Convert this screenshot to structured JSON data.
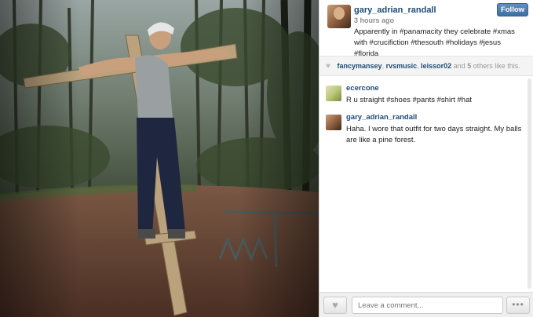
{
  "post": {
    "username": "gary_adrian_randall",
    "time_ago": "3 hours ago",
    "caption": "Apparently in #panamacity they celebrate #xmas with #crucifiction #thesouth #holidays #jesus #florida",
    "follow_label": "Follow"
  },
  "likes": {
    "users": [
      "fancymansey",
      "rvsmusic",
      "leissor02"
    ],
    "separator_1": ", ",
    "separator_2": ", ",
    "and_text": " and ",
    "others_count": "5",
    "others_suffix": " others like this."
  },
  "comments": [
    {
      "username": "ecercone",
      "text": "R u straight #shoes #pants #shirt #hat"
    },
    {
      "username": "gary_adrian_randall",
      "text": "Haha. I wore that outfit for two days straight. My balls are like a pine forest."
    }
  ],
  "footer": {
    "comment_placeholder": "Leave a comment...",
    "more_label": "•••",
    "like_icon": "heart-icon"
  },
  "colors": {
    "username_blue": "#1d4b77",
    "follow_button": "#3e6fa3"
  }
}
